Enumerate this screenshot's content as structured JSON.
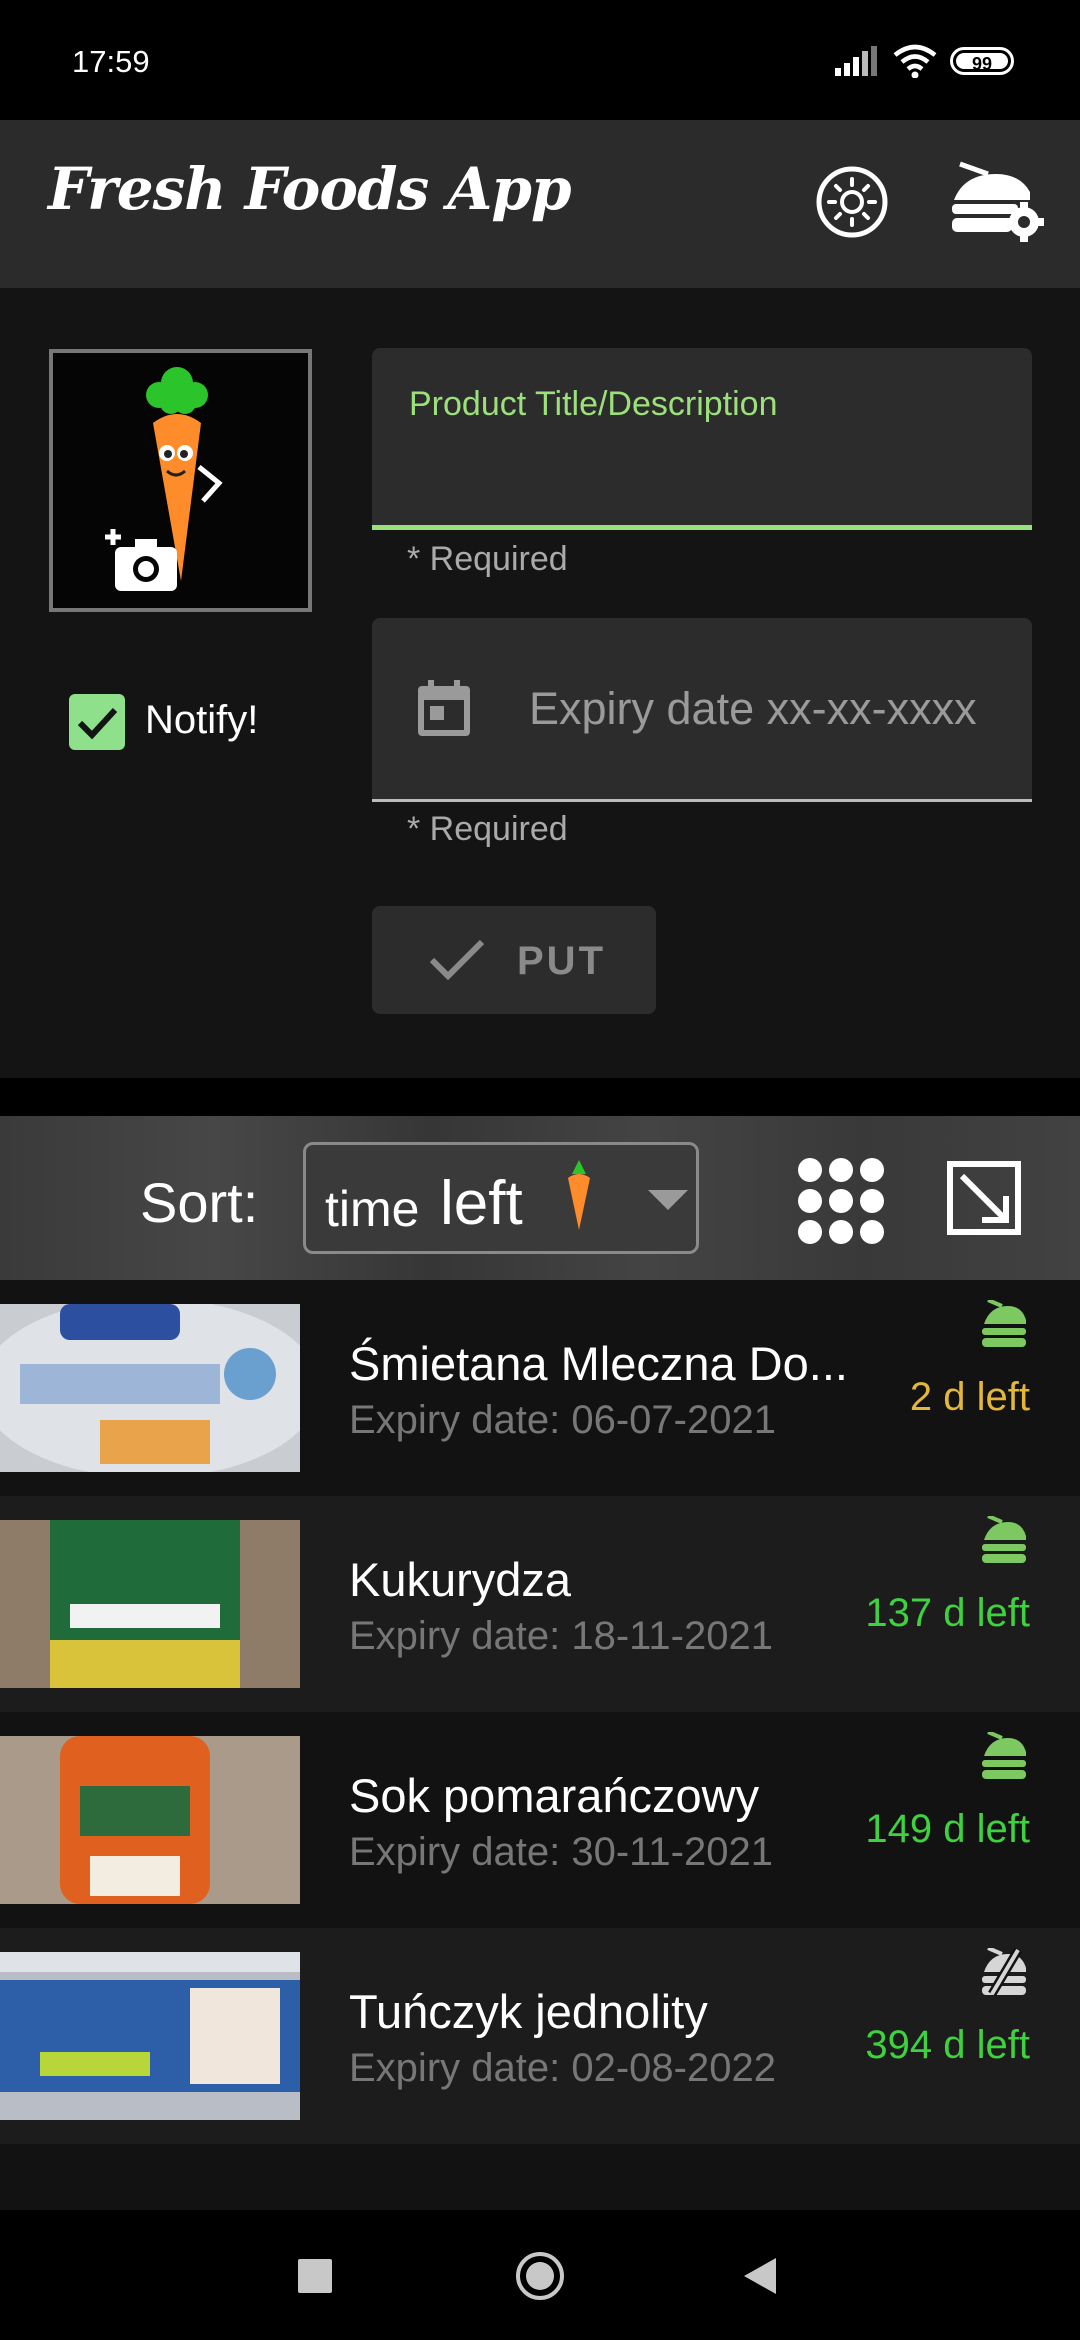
{
  "status_bar": {
    "time": "17:59",
    "battery": "99"
  },
  "app_bar": {
    "title": "Fresh Foods App",
    "theme_icon": "sun-brightness-icon",
    "settings_icon": "food-settings-icon"
  },
  "form": {
    "photo_icon": "add-photo-icon",
    "notify_label": "Notify!",
    "notify_checked": true,
    "title_field_label": "Product Title/Description",
    "title_field_value": "",
    "title_helper": "* Required",
    "date_field_placeholder": "Expiry date xx-xx-xxxx",
    "date_helper": "* Required",
    "put_button_label": "PUT"
  },
  "sort": {
    "label": "Sort:",
    "selected_a": "time",
    "selected_b": "left"
  },
  "products": [
    {
      "name": "Śmietana Mleczna Do...",
      "expiry": "Expiry date: 06-07-2021",
      "left": "2 d left",
      "left_color": "#e2b73a",
      "icon": "notify-on-icon"
    },
    {
      "name": "Kukurydza",
      "expiry": "Expiry date: 18-11-2021",
      "left": "137 d left",
      "left_color": "#3fd13f",
      "icon": "notify-on-icon"
    },
    {
      "name": "Sok pomarańczowy",
      "expiry": "Expiry date: 30-11-2021",
      "left": "149 d left",
      "left_color": "#3fd13f",
      "icon": "notify-on-icon"
    },
    {
      "name": "Tuńczyk jednolity",
      "expiry": "Expiry date: 02-08-2022",
      "left": "394 d left",
      "left_color": "#3fd13f",
      "icon": "notify-off-icon"
    }
  ],
  "colors": {
    "accent": "#9be07a",
    "warning": "#e2b73a",
    "fresh": "#3fd13f",
    "icon_green": "#7dc860"
  }
}
